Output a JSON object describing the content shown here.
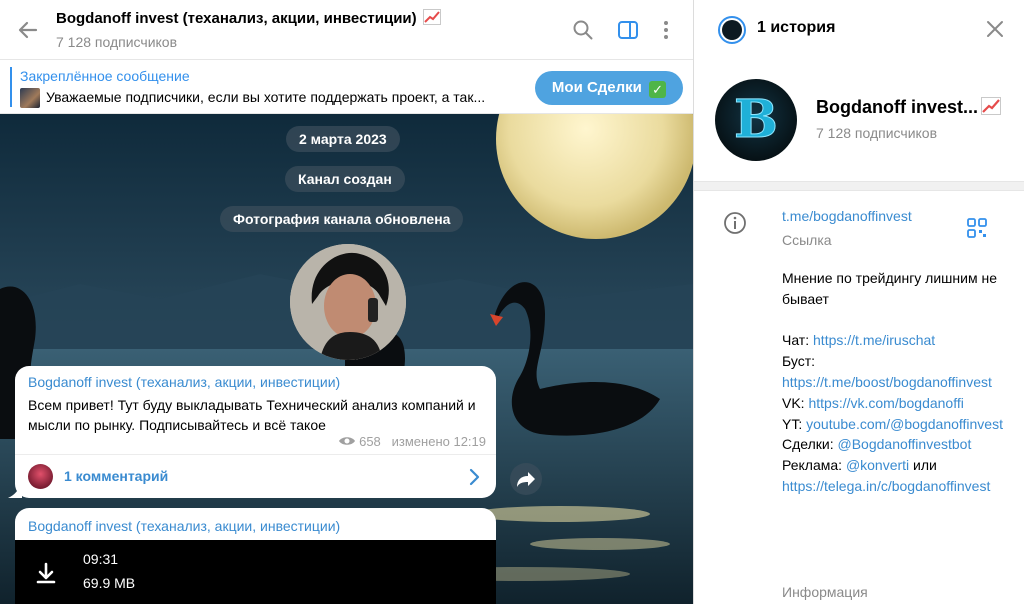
{
  "header": {
    "title": "Bogdanoff invest (теханализ, акции, инвестиции)",
    "subscribers": "7 128 подписчиков"
  },
  "pinned": {
    "label": "Закреплённое сообщение",
    "text": "Уважаемые подписчики, если вы хотите поддержать проект, а так...",
    "button": "Мои Сделки"
  },
  "chat": {
    "services": [
      "2 марта 2023",
      "Канал создан",
      "Фотография канала обновлена"
    ],
    "message1": {
      "author": "Bogdanoff invest (теханализ, акции, инвестиции)",
      "text": "Всем привет! Тут буду выкладывать Технический анализ компаний и мысли по рынку. Подписывайтесь и всё такое",
      "views": "658",
      "edited": "изменено 12:19",
      "comments": "1 комментарий"
    },
    "message2": {
      "author": "Bogdanoff invest (теханализ, акции, инвестиции)",
      "duration": "09:31",
      "size": "69.9 MB"
    }
  },
  "sidebar": {
    "stories": "1 история",
    "name": "Bogdanoff invest...",
    "subscribers": "7 128 подписчиков",
    "avatar_letter": "B",
    "link": "t.me/bogdanoffinvest",
    "link_label": "Ссылка",
    "description": {
      "line1": "Мнение по трейдингу лишним не бывает",
      "chat_label": "Чат: ",
      "chat_url": "https://t.me/iruschat",
      "boost_label": "Буст: ",
      "boost_url": "https://t.me/boost/bogdanoffinvest",
      "vk_label": "VK: ",
      "vk_url": "https://vk.com/bogdanoffi",
      "yt_label": "YT: ",
      "yt_url": "youtube.com/@bogdanoffinvest",
      "deals_label": "Сделки: ",
      "deals_handle": "@Bogdanoffinvestbot",
      "ads_label": "Реклама: ",
      "ads_handle": "@konverti",
      "ads_or": " или ",
      "ads_url": "https://telega.in/c/bogdanoffinvest"
    },
    "info_label": "Информация"
  },
  "colors": {
    "accent": "#3390ec",
    "link": "#3a8bd0",
    "pinned_button": "#4fa3e0"
  },
  "icons": [
    "back-arrow-icon",
    "search-icon",
    "sidebar-toggle-icon",
    "more-vertical-icon",
    "chart-up-emoji-icon",
    "checkmark-emoji-icon",
    "eye-icon",
    "chevron-right-icon",
    "share-icon",
    "download-icon",
    "close-icon",
    "info-icon",
    "qr-code-icon"
  ]
}
